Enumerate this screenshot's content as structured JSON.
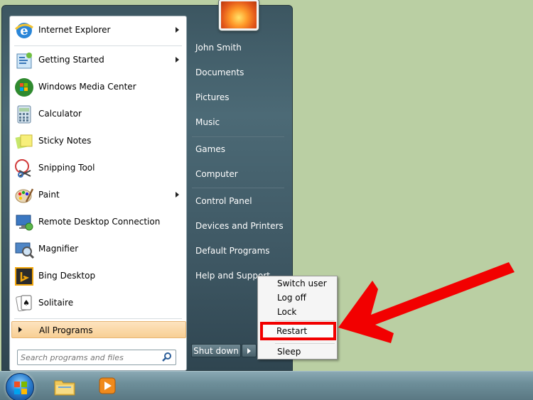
{
  "start_menu": {
    "pinned_programs": [
      {
        "label": "Internet Explorer",
        "icon": "internet-explorer-icon",
        "has_submenu": true
      },
      {
        "label": "Getting Started",
        "icon": "getting-started-icon",
        "has_submenu": true
      },
      {
        "label": "Windows Media Center",
        "icon": "media-center-icon",
        "has_submenu": false
      },
      {
        "label": "Calculator",
        "icon": "calculator-icon",
        "has_submenu": false
      },
      {
        "label": "Sticky Notes",
        "icon": "sticky-notes-icon",
        "has_submenu": false
      },
      {
        "label": "Snipping Tool",
        "icon": "snipping-tool-icon",
        "has_submenu": false
      },
      {
        "label": "Paint",
        "icon": "paint-icon",
        "has_submenu": true
      },
      {
        "label": "Remote Desktop Connection",
        "icon": "remote-desktop-icon",
        "has_submenu": false
      },
      {
        "label": "Magnifier",
        "icon": "magnifier-icon",
        "has_submenu": false
      },
      {
        "label": "Bing Desktop",
        "icon": "bing-icon",
        "has_submenu": false
      },
      {
        "label": "Solitaire",
        "icon": "solitaire-icon",
        "has_submenu": false
      }
    ],
    "all_programs_label": "All Programs",
    "search_placeholder": "Search programs and files",
    "right_pane": {
      "user_name": "John Smith",
      "items": [
        "Documents",
        "Pictures",
        "Music",
        "Games",
        "Computer",
        "Control Panel",
        "Devices and Printers",
        "Default Programs",
        "Help and Support"
      ]
    },
    "shutdown_label": "Shut down",
    "power_menu": [
      "Switch user",
      "Log off",
      "Lock",
      "Restart",
      "Sleep"
    ]
  },
  "colors": {
    "annotation_red": "#f20000",
    "all_programs_highlight": "#f8cf94",
    "desktop_background": "#bacfa3"
  },
  "taskbar": {
    "start_icon": "windows-orb-icon",
    "pinned": [
      "file-explorer-icon",
      "media-player-icon"
    ]
  }
}
